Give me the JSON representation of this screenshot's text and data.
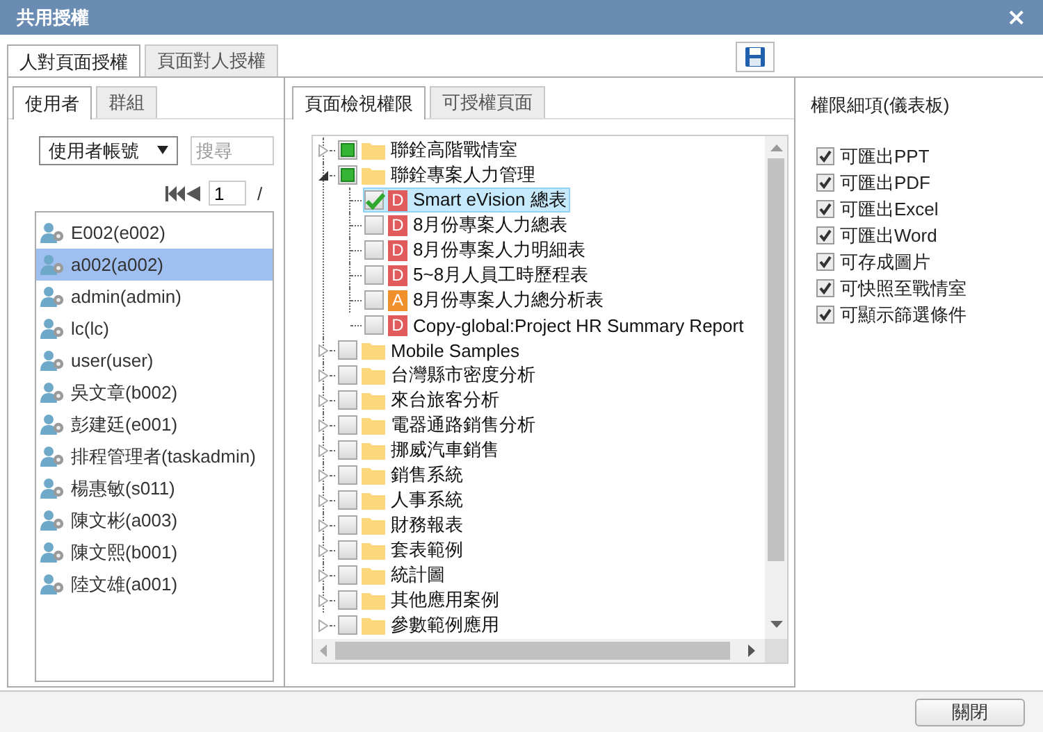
{
  "window": {
    "title": "共用授權",
    "close": "×"
  },
  "main_tabs": [
    {
      "label": "人對頁面授權",
      "selected": true
    },
    {
      "label": "頁面對人授權",
      "selected": false
    }
  ],
  "user_panel": {
    "tabs": [
      {
        "label": "使用者",
        "selected": true
      },
      {
        "label": "群組",
        "selected": false
      }
    ],
    "filter": {
      "value": "使用者帳號"
    },
    "search": {
      "placeholder": "搜尋"
    },
    "pager": {
      "page": "1",
      "separator": "/"
    },
    "users": [
      {
        "name": "E002(e002)",
        "selected": false
      },
      {
        "name": "a002(a002)",
        "selected": true
      },
      {
        "name": "admin(admin)",
        "selected": false
      },
      {
        "name": "lc(lc)",
        "selected": false
      },
      {
        "name": "user(user)",
        "selected": false
      },
      {
        "name": "吳文章(b002)",
        "selected": false
      },
      {
        "name": "彭建廷(e001)",
        "selected": false
      },
      {
        "name": "排程管理者(taskadmin)",
        "selected": false
      },
      {
        "name": "楊惠敏(s011)",
        "selected": false
      },
      {
        "name": "陳文彬(a003)",
        "selected": false
      },
      {
        "name": "陳文熙(b001)",
        "selected": false
      },
      {
        "name": "陸文雄(a001)",
        "selected": false
      }
    ]
  },
  "page_panel": {
    "tabs": [
      {
        "label": "頁面檢視權限",
        "selected": true
      },
      {
        "label": "可授權頁面",
        "selected": false
      }
    ],
    "tree": [
      {
        "kind": "folder",
        "label": "聯銓高階戰情室",
        "checked": false,
        "partial": true,
        "expanded": false,
        "selected": false
      },
      {
        "kind": "folder",
        "label": "聯銓專案人力管理",
        "checked": false,
        "partial": true,
        "expanded": true,
        "selected": false,
        "children": [
          {
            "kind": "report",
            "badge": "D",
            "color": "#e05c5c",
            "label": "Smart eVision 總表",
            "checked": true,
            "selected": true
          },
          {
            "kind": "report",
            "badge": "D",
            "color": "#e05c5c",
            "label": "8月份專案人力總表",
            "checked": false,
            "selected": false
          },
          {
            "kind": "report",
            "badge": "D",
            "color": "#e05c5c",
            "label": "8月份專案人力明細表",
            "checked": false,
            "selected": false
          },
          {
            "kind": "report",
            "badge": "D",
            "color": "#e05c5c",
            "label": "5~8月人員工時歷程表",
            "checked": false,
            "selected": false
          },
          {
            "kind": "report",
            "badge": "A",
            "color": "#f0902c",
            "label": "8月份專案人力總分析表",
            "checked": false,
            "selected": false
          },
          {
            "kind": "report",
            "badge": "D",
            "color": "#e05c5c",
            "label": "Copy-global:Project HR Summary Report",
            "checked": false,
            "selected": false
          }
        ]
      },
      {
        "kind": "folder",
        "label": "Mobile Samples",
        "checked": false,
        "partial": false,
        "expanded": false,
        "selected": false
      },
      {
        "kind": "folder",
        "label": "台灣縣市密度分析",
        "checked": false,
        "partial": false,
        "expanded": false,
        "selected": false
      },
      {
        "kind": "folder",
        "label": "來台旅客分析",
        "checked": false,
        "partial": false,
        "expanded": false,
        "selected": false
      },
      {
        "kind": "folder",
        "label": "電器通路銷售分析",
        "checked": false,
        "partial": false,
        "expanded": false,
        "selected": false
      },
      {
        "kind": "folder",
        "label": "挪威汽車銷售",
        "checked": false,
        "partial": false,
        "expanded": false,
        "selected": false
      },
      {
        "kind": "folder",
        "label": "銷售系統",
        "checked": false,
        "partial": false,
        "expanded": false,
        "selected": false
      },
      {
        "kind": "folder",
        "label": "人事系統",
        "checked": false,
        "partial": false,
        "expanded": false,
        "selected": false
      },
      {
        "kind": "folder",
        "label": "財務報表",
        "checked": false,
        "partial": false,
        "expanded": false,
        "selected": false
      },
      {
        "kind": "folder",
        "label": "套表範例",
        "checked": false,
        "partial": false,
        "expanded": false,
        "selected": false
      },
      {
        "kind": "folder",
        "label": "統計圖",
        "checked": false,
        "partial": false,
        "expanded": false,
        "selected": false
      },
      {
        "kind": "folder",
        "label": "其他應用案例",
        "checked": false,
        "partial": false,
        "expanded": false,
        "selected": false
      },
      {
        "kind": "folder",
        "label": "參數範例應用",
        "checked": false,
        "partial": false,
        "expanded": false,
        "selected": false
      }
    ]
  },
  "permissions": {
    "title": "權限細項(儀表板)",
    "items": [
      {
        "label": "可匯出PPT",
        "checked": true
      },
      {
        "label": "可匯出PDF",
        "checked": true
      },
      {
        "label": "可匯出Excel",
        "checked": true
      },
      {
        "label": "可匯出Word",
        "checked": true
      },
      {
        "label": "可存成圖片",
        "checked": true
      },
      {
        "label": "可快照至戰情室",
        "checked": true
      },
      {
        "label": "可顯示篩選條件",
        "checked": true
      }
    ]
  },
  "footer": {
    "close_button": "關閉"
  }
}
